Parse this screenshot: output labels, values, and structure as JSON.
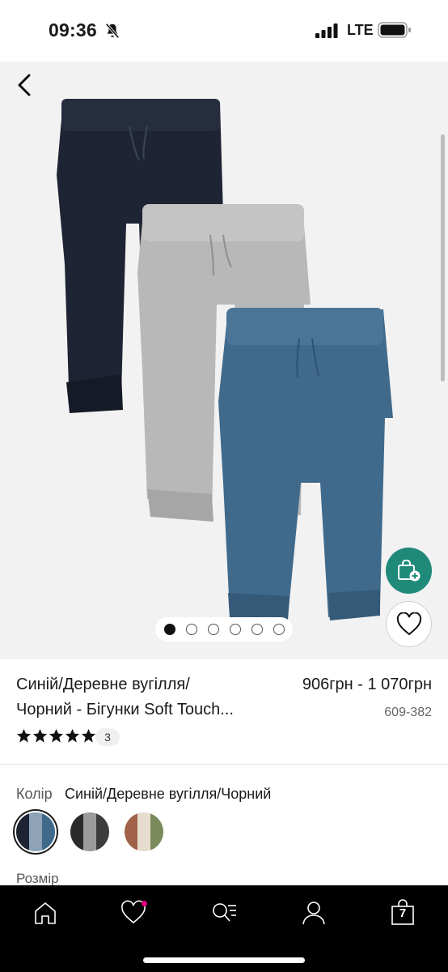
{
  "status_bar": {
    "time": "09:36",
    "network": "LTE",
    "icons": [
      "bell-slash-icon",
      "signal-icon",
      "battery-icon"
    ]
  },
  "gallery": {
    "back_icon": "chevron-left-icon",
    "image_description_icon": "product-image",
    "dots_total": 6,
    "active_dot": 1,
    "fab_icons": [
      "bag-plus-icon",
      "heart-icon"
    ],
    "trouser_colors": [
      "#1e2433",
      "#b8b8b8",
      "#3f6a8c"
    ]
  },
  "product": {
    "title_line1": "Синій/Деревне вугілля/",
    "title_line2": "Чорний - Бігунки Soft Touch...",
    "price": "906грн - 1 070грн",
    "sku": "609-382",
    "rating": 5,
    "review_count": "3"
  },
  "colour": {
    "label": "Колір",
    "value": "Синій/Деревне вугілля/Чорний",
    "swatches": [
      {
        "name": "navy-blue",
        "selected": true,
        "colors": [
          "#1e2433",
          "#8ea3b8",
          "#3f6a8c"
        ]
      },
      {
        "name": "charcoal",
        "selected": false,
        "colors": [
          "#2b2b2b",
          "#9b9b9b",
          "#3d3d3d"
        ]
      },
      {
        "name": "brown",
        "selected": false,
        "colors": [
          "#a0634a",
          "#e6ddcf",
          "#7b8a5a"
        ]
      }
    ]
  },
  "size": {
    "label": "Розмір"
  },
  "bottom_nav": {
    "items": [
      "home-icon",
      "heart-icon",
      "search-list-icon",
      "account-icon",
      "bag-icon"
    ],
    "bag_count": "7",
    "accent": "#e6007a"
  }
}
